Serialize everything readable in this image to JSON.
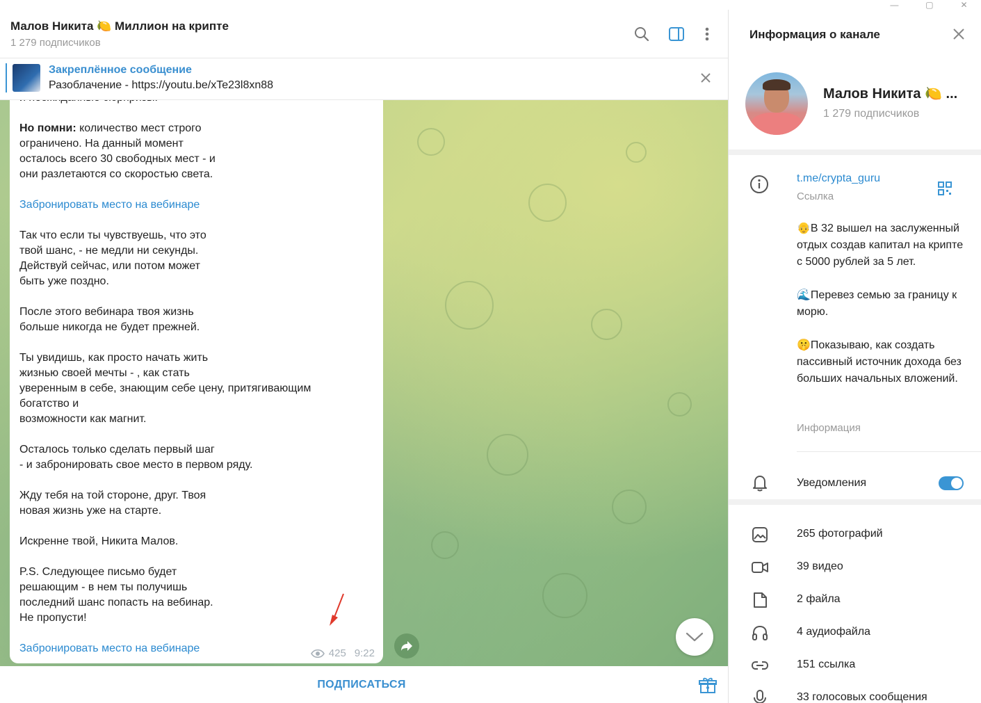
{
  "chat": {
    "title": "Малов Никита 🍋 Миллион на крипте",
    "subscribers": "1 279 подписчиков"
  },
  "pinned": {
    "title": "Закреплённое сообщение",
    "text": "Разоблачение - https://youtu.be/xTe23l8xn88"
  },
  "message": {
    "cut_line": "и неожиданные сюрпризы.",
    "remember_bold": "Но помни:",
    "remember_text": " количество мест строго\nограничено. На данный момент\nосталось всего 30 свободных мест - и\nони разлетаются со скоростью света.",
    "link1": "Забронировать место на вебинаре",
    "para_chance": "Так что если ты чувствуешь, что это\nтвой шанс, - не медли ни секунды.\nДействуй сейчас, или потом может\nбыть уже поздно.",
    "para_after": "После этого вебинара твоя жизнь\nбольше никогда не будет прежней.",
    "para_see": "Ты увидишь, как просто начать жить\nжизнью своей мечты - , как стать\nуверенным в себе, знающим себе цену, притягивающим\nбогатство и\nвозможности как магнит.",
    "para_step": "Осталось только сделать первый шаг\n- и забронировать свое место в первом ряду.",
    "para_wait": "Жду тебя на той стороне, друг. Твоя\nновая жизнь уже на старте.",
    "para_sign": "Искренне твой, Никита Малов.",
    "para_ps": "P.S. Следующее письмо будет\nрешающим - в нем ты получишь\nпоследний шанс попасть на вебинар.\nНе пропусти!",
    "link2": "Забронировать место на вебинаре",
    "views": "425",
    "time": "9:22"
  },
  "bottom": {
    "subscribe": "ПОДПИСАТЬСЯ"
  },
  "panel": {
    "title": "Информация о канале",
    "channel_name": "Малов Никита 🍋 ...",
    "subscribers": "1 279 подписчиков",
    "link": "t.me/crypta_guru",
    "link_label": "Ссылка",
    "desc1": "👴В 32 вышел на заслуженный отдых создав капитал на крипте с 5000 рублей за 5 лет.",
    "desc2": "🌊Перевез семью за границу к морю.",
    "desc3": "🤫Показываю, как создать пассивный источник дохода без больших начальных вложений.",
    "desc_label": "Информация",
    "notifications": "Уведомления",
    "notifications_on": true,
    "media": [
      {
        "icon": "photo-icon",
        "label": "265 фотографий"
      },
      {
        "icon": "video-icon",
        "label": "39 видео"
      },
      {
        "icon": "file-icon",
        "label": "2 файла"
      },
      {
        "icon": "headphones-icon",
        "label": "4 аудиофайла"
      },
      {
        "icon": "link-icon",
        "label": "151 ссылка"
      },
      {
        "icon": "microphone-icon",
        "label": "33 голосовых сообщения"
      }
    ]
  },
  "colors": {
    "accent": "#3a8fd0",
    "link": "#2b8ad0",
    "annotation_arrow": "#e0392b"
  }
}
